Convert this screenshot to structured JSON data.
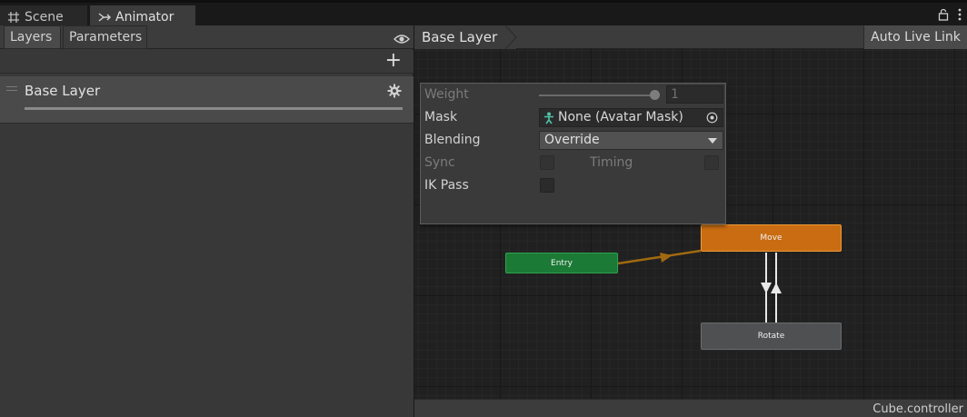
{
  "tabs": {
    "scene_label": "Scene",
    "animator_label": "Animator"
  },
  "left_panel": {
    "subtabs": {
      "layers_label": "Layers",
      "parameters_label": "Parameters"
    },
    "add_label": "+",
    "layer": {
      "name": "Base Layer"
    }
  },
  "graph": {
    "breadcrumb": "Base Layer",
    "auto_live_link_label": "Auto Live Link",
    "status_text": "Cube.controller",
    "nodes": {
      "entry": "Entry",
      "move": "Move",
      "rotate": "Rotate"
    }
  },
  "layer_settings": {
    "weight_label": "Weight",
    "weight_value": "1",
    "weight_fraction": 1.0,
    "mask_label": "Mask",
    "mask_value": "None (Avatar Mask)",
    "blending_label": "Blending",
    "blending_value": "Override",
    "sync_label": "Sync",
    "timing_label": "Timing",
    "ik_pass_label": "IK Pass",
    "sync_checked": false,
    "timing_checked": false,
    "ik_pass_checked": false
  },
  "colors": {
    "entry_node": "#1b7a35",
    "default_state": "#c96c12",
    "state": "#4f5052",
    "transition_default": "#a06a10",
    "transition": "#e8e8e8"
  }
}
